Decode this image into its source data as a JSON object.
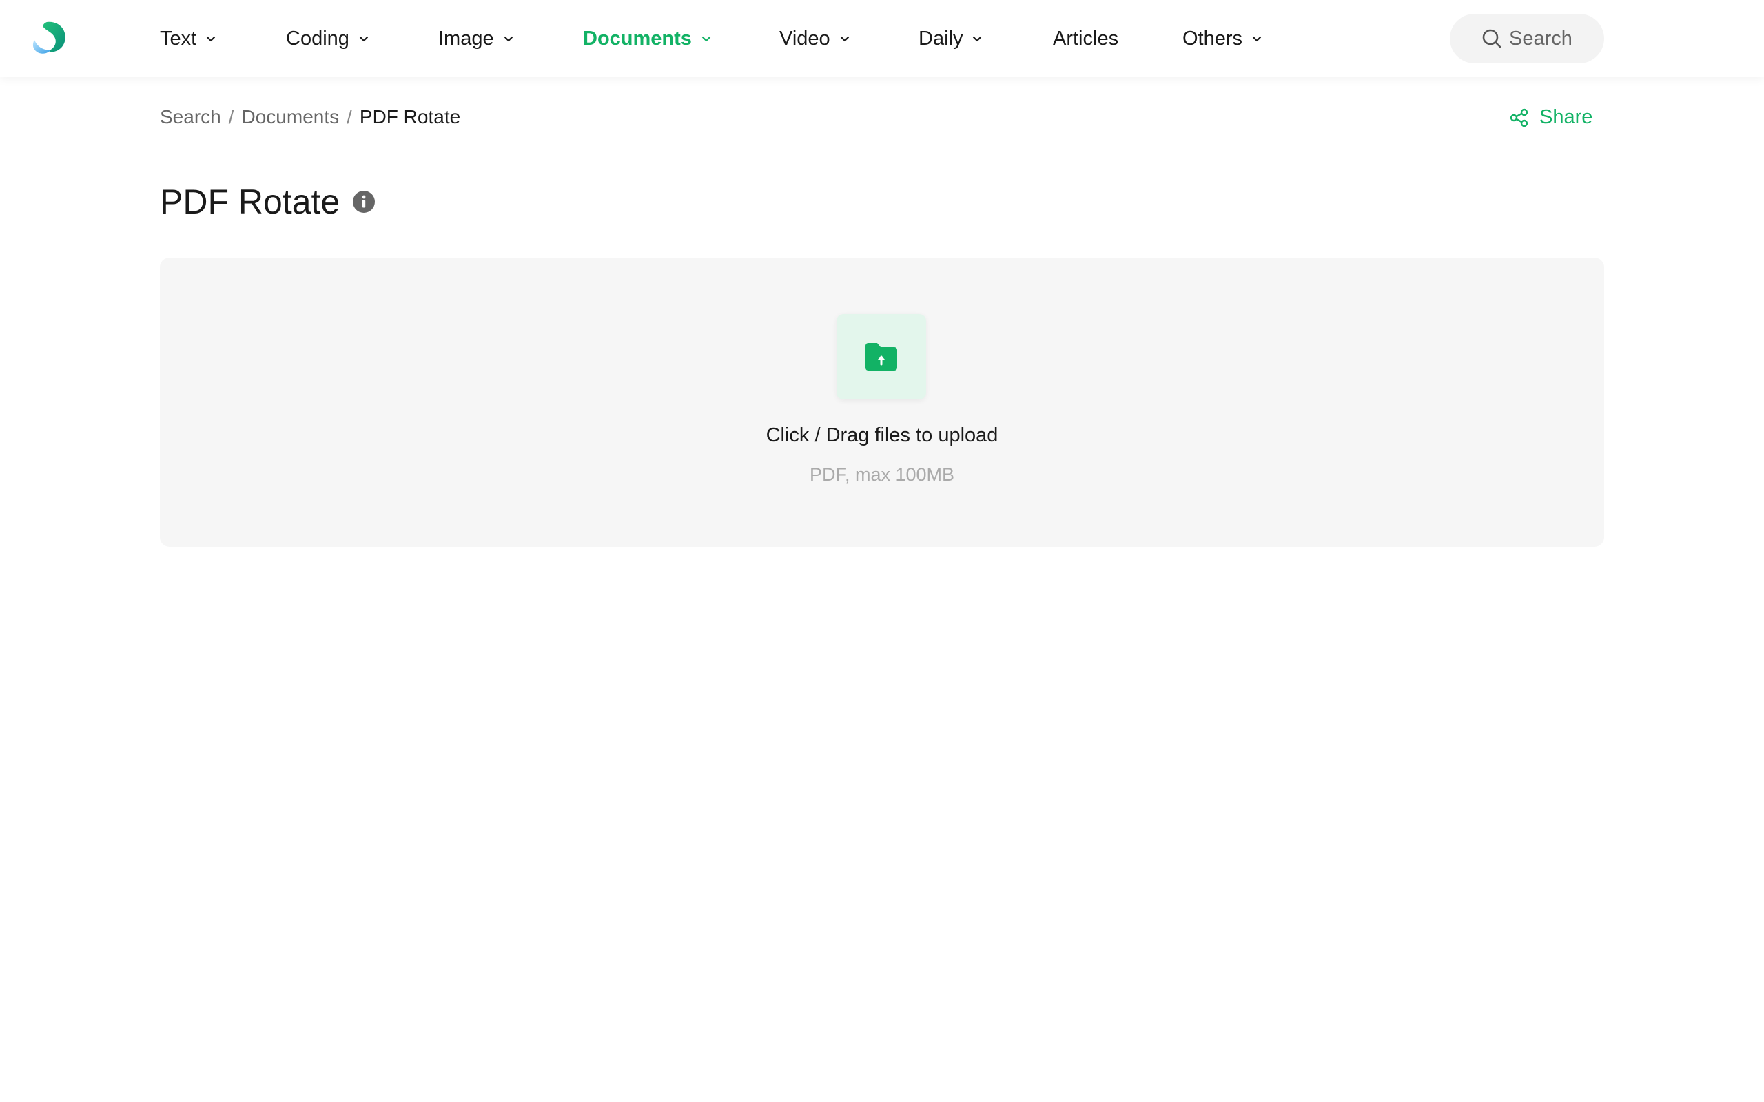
{
  "colors": {
    "accent": "#12b265",
    "text": "#1a1a1a",
    "muted": "#666666",
    "hint": "#aaaaaa",
    "panel": "#f6f6f6",
    "icon_box": "#e3f6ec"
  },
  "header": {
    "logo_icon": "brand-logo",
    "nav": [
      {
        "label": "Text",
        "has_dropdown": true,
        "active": false
      },
      {
        "label": "Coding",
        "has_dropdown": true,
        "active": false
      },
      {
        "label": "Image",
        "has_dropdown": true,
        "active": false
      },
      {
        "label": "Documents",
        "has_dropdown": true,
        "active": true
      },
      {
        "label": "Video",
        "has_dropdown": true,
        "active": false
      },
      {
        "label": "Daily",
        "has_dropdown": true,
        "active": false
      },
      {
        "label": "Articles",
        "has_dropdown": false,
        "active": false
      },
      {
        "label": "Others",
        "has_dropdown": true,
        "active": false
      }
    ],
    "search_label": "Search",
    "search_icon": "search-icon"
  },
  "breadcrumb": {
    "items": [
      "Search",
      "Documents",
      "PDF Rotate"
    ],
    "separator": "/"
  },
  "share": {
    "label": "Share",
    "icon": "share-icon"
  },
  "page": {
    "title": "PDF Rotate",
    "info_icon": "info-icon"
  },
  "upload": {
    "icon": "folder-upload-icon",
    "prompt": "Click / Drag files to upload",
    "hint": "PDF, max 100MB"
  }
}
